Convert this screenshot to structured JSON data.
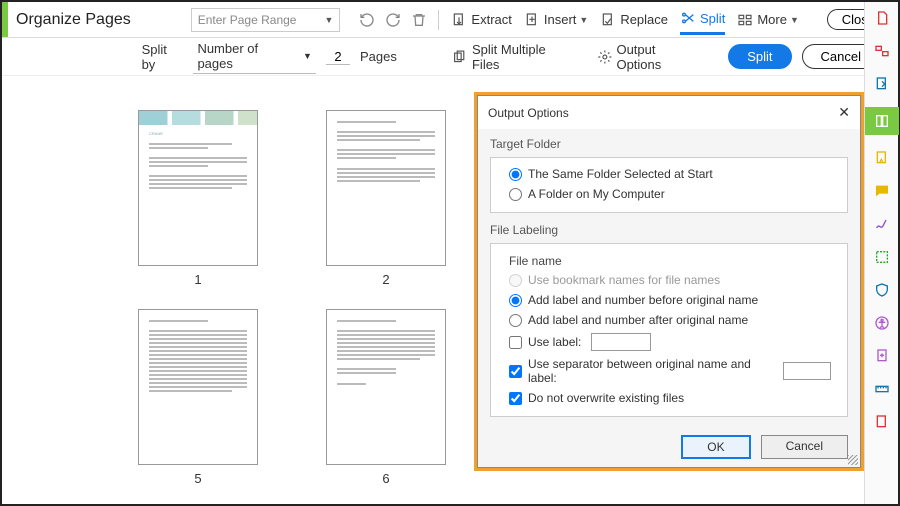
{
  "title": "Organize Pages",
  "toolbar": {
    "page_range_placeholder": "Enter Page Range",
    "extract": "Extract",
    "insert": "Insert",
    "replace": "Replace",
    "split": "Split",
    "more": "More",
    "close": "Close"
  },
  "subbar": {
    "split_by": "Split by",
    "mode": "Number of pages",
    "count": "2",
    "pages": "Pages",
    "multi": "Split Multiple Files",
    "output_options": "Output Options",
    "split_btn": "Split",
    "cancel_btn": "Cancel"
  },
  "thumbs": [
    "1",
    "2",
    "5",
    "6"
  ],
  "dialog": {
    "title": "Output Options",
    "target_folder": "Target Folder",
    "opt_same": "The Same Folder Selected at Start",
    "opt_other": "A Folder on My Computer",
    "file_labeling": "File Labeling",
    "file_name": "File name",
    "use_bookmarks": "Use bookmark names for file names",
    "before": "Add label and number before original name",
    "after": "Add label and number after original name",
    "use_label": "Use label:",
    "use_sep": "Use separator between original name and label:",
    "no_overwrite": "Do not overwrite existing files",
    "ok": "OK",
    "cancel": "Cancel"
  }
}
